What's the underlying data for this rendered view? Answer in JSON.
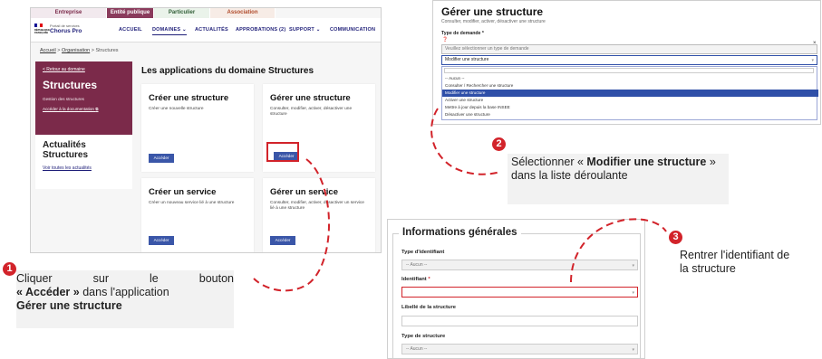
{
  "shot1": {
    "audience_tabs": [
      "Entreprise",
      "Entité publique",
      "Particulier",
      "Association"
    ],
    "logo": {
      "top": "Portail de services",
      "brand": "Chorus Pro",
      "gov": "RÉPUBLIQUE FRANÇAISE"
    },
    "nav": [
      "ACCUEIL",
      "DOMAINES",
      "ACTUALITÉS",
      "APPROBATIONS (2)",
      "SUPPORT",
      "COMMUNICATION"
    ],
    "breadcrumb": {
      "home": "Accueil",
      "sep1": ">",
      "section": "Organisation",
      "sep2": ">",
      "current": "Structures"
    },
    "side": {
      "back": "< Retour au domaine",
      "title": "Structures",
      "desc": "Gestion des structures",
      "doc": "Accéder à la documentation"
    },
    "news": {
      "title": "Actualités Structures",
      "link": "Voir toutes les actualités"
    },
    "apps_title": "Les applications du domaine Structures",
    "cards": [
      {
        "title": "Créer une structure",
        "desc": "Créer une nouvelle structure",
        "button": "Accéder"
      },
      {
        "title": "Gérer une structure",
        "desc": "Consulter, modifier, activer, désactiver une structure",
        "button": "Accéder"
      },
      {
        "title": "Créer un service",
        "desc": "Créer un nouveau service lié à une structure",
        "button": "Accéder"
      },
      {
        "title": "Gérer un service",
        "desc": "Consulter, modifier, activer, désactiver un service lié à une structure",
        "button": "Accéder"
      }
    ]
  },
  "shot2": {
    "title": "Gérer une structure",
    "subtitle": "Consulter, modifier, activer, désactiver une structure",
    "type_label": "Type de demande *",
    "help_icon": "question-icon",
    "select_placeholder": "Veuillez sélectionner un type de demande",
    "select_value": "Modifier une structure",
    "options": [
      "-- Aucun --",
      "Consulter / Rechercher une structure",
      "Modifier une structure",
      "Activer une structure",
      "Mettre à jour depuis la base INSEE",
      "Désactiver une structure"
    ]
  },
  "shot3": {
    "legend": "Informations générales",
    "fields": [
      {
        "label": "Type d'identifiant",
        "value": "-- Aucun --"
      },
      {
        "label": "Identifiant",
        "required": "*",
        "value": ""
      },
      {
        "label": "Libellé de la structure",
        "value": ""
      },
      {
        "label": "Type de structure",
        "value": "-- Aucun --"
      }
    ]
  },
  "callouts": {
    "c1": {
      "num": "1",
      "line1": "Cliquer sur le bouton",
      "bold1": "« Accéder »",
      "mid": " dans l'application",
      "bold2": "Gérer une structure"
    },
    "c2": {
      "num": "2",
      "pre": "Sélectionner « ",
      "bold": "Modifier une structure",
      "post": " » dans la liste déroulante"
    },
    "c3": {
      "num": "3",
      "text": "Rentrer l'identifiant de la structure"
    }
  },
  "colors": {
    "accent_red": "#d2232a",
    "domain_purple": "#7b2a4a",
    "button_blue": "#3a56a8",
    "nav_blue": "#1e1e78"
  }
}
